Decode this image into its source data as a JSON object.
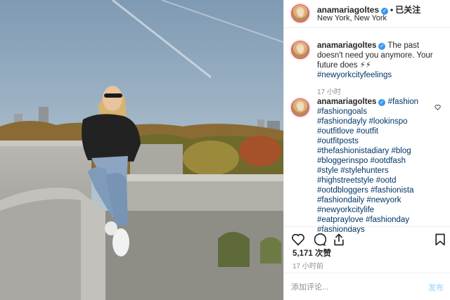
{
  "header": {
    "username": "anamariagoltes",
    "verified_mark": "✓",
    "separator": "•",
    "follow_label": "已关注",
    "location": "New York, New York"
  },
  "caption": {
    "username": "anamariagoltes",
    "verified_mark": "✓",
    "text": "The past doesn't need you anymore. Your future does ⚡⚡",
    "hashtag": "#newyorkcityfeelings",
    "time": "17 小时"
  },
  "comment": {
    "username": "anamariagoltes",
    "verified_mark": "✓",
    "lines": [
      "#fashion",
      "#fashiongoals",
      "#fashiondayly #lookinspo",
      "#outfitlove #outfit",
      "#outfitposts",
      "#thefashionistadiary #blog",
      "#bloggerinspo #ootdfash",
      "#style #stylehunters",
      "#highstreetstyle #ootd",
      "#ootdbloggers #fashionista",
      "#fashiondaily #newyork",
      "#newyorkcitylife",
      "#eatpraylove #fashionday",
      "#fashiondays"
    ]
  },
  "actions": {
    "icons": [
      "heart-icon",
      "comment-icon",
      "share-icon",
      "bookmark-icon"
    ]
  },
  "likes_label": "5,171 次赞",
  "posted_ago": "17 小时前",
  "add_comment": {
    "placeholder": "添加评论...",
    "post_label": "发布"
  },
  "colors": {
    "hashtag": "#003569",
    "verified": "#3897f0",
    "muted": "#8e8e8e",
    "post_disabled": "#b2dffc"
  }
}
